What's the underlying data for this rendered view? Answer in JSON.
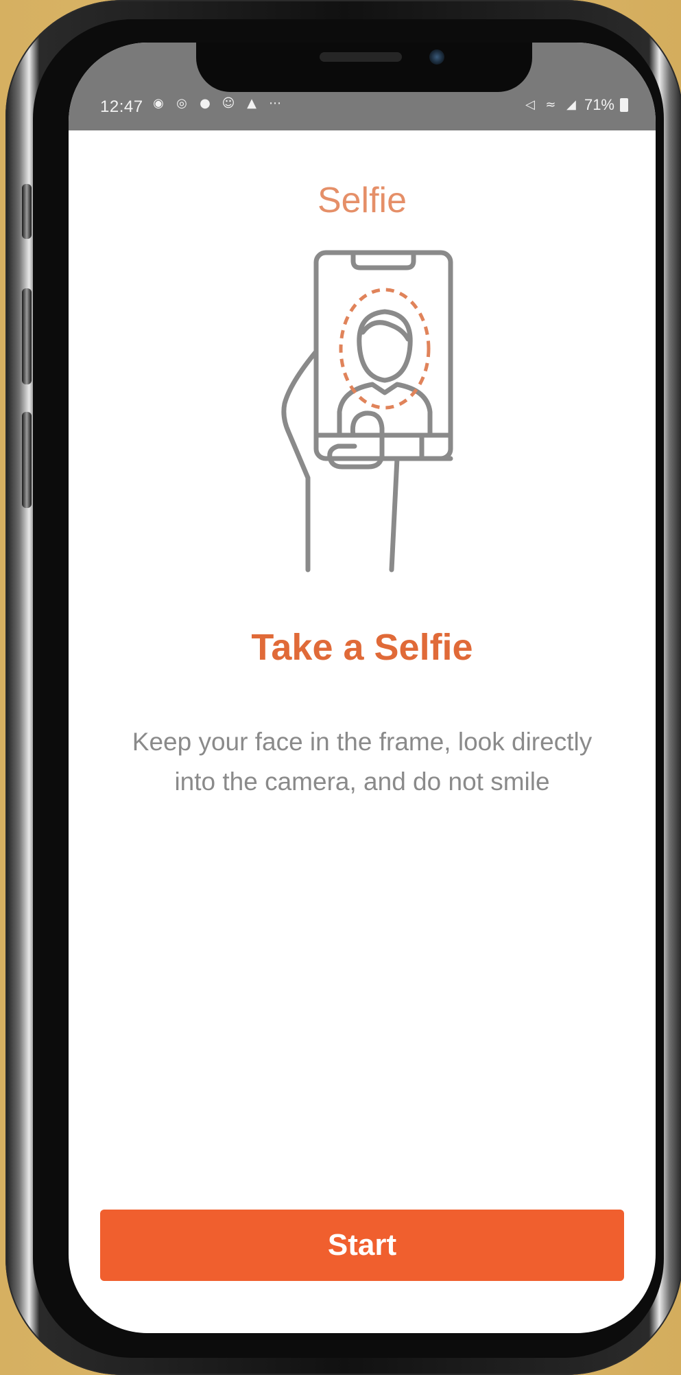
{
  "status_bar": {
    "time": "12:47",
    "left_icons": [
      "messenger-icon",
      "whatsapp-icon",
      "facebook-icon",
      "account-icon",
      "warning-icon",
      "more-icon"
    ],
    "right_text": "71%",
    "right_icons": [
      "mute-icon",
      "wifi-icon",
      "signal-icon",
      "battery-icon"
    ]
  },
  "page": {
    "title": "Selfie",
    "heading": "Take a Selfie",
    "description": "Keep your face in the frame, look directly into the camera, and do not smile"
  },
  "actions": {
    "start_label": "Start"
  },
  "colors": {
    "title": "#e58f68",
    "heading": "#e06a38",
    "accent": "#f05f2e",
    "illustration_stroke": "#8a8a8a",
    "face_outline": "#e0835a",
    "status_bar": "#7a7a7a"
  }
}
